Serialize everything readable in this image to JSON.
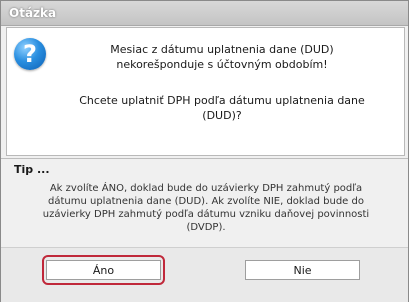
{
  "window": {
    "title": "Otázka"
  },
  "message": {
    "line1": "Mesiac z dátumu uplatnenia dane (DUD) nekorešponduje s účtovným obdobím!",
    "question": "Chcete uplatniť DPH podľa dátumu uplatnenia dane (DUD)?"
  },
  "tip": {
    "label": "Tip ...",
    "text": "Ak zvolíte ÁNO, doklad bude do uzávierky DPH zahmutý podľa dátumu uplatnenia dane (DUD). Ak zvolíte NIE, doklad bude do uzávierky DPH zahmutý podľa dátumu vzniku daňovej povinnosti (DVDP)."
  },
  "buttons": {
    "yes": "Áno",
    "no": "Nie"
  },
  "icons": {
    "question": "question-icon"
  },
  "colors": {
    "highlight": "#c0283a",
    "icon": "#2a8fe0"
  }
}
